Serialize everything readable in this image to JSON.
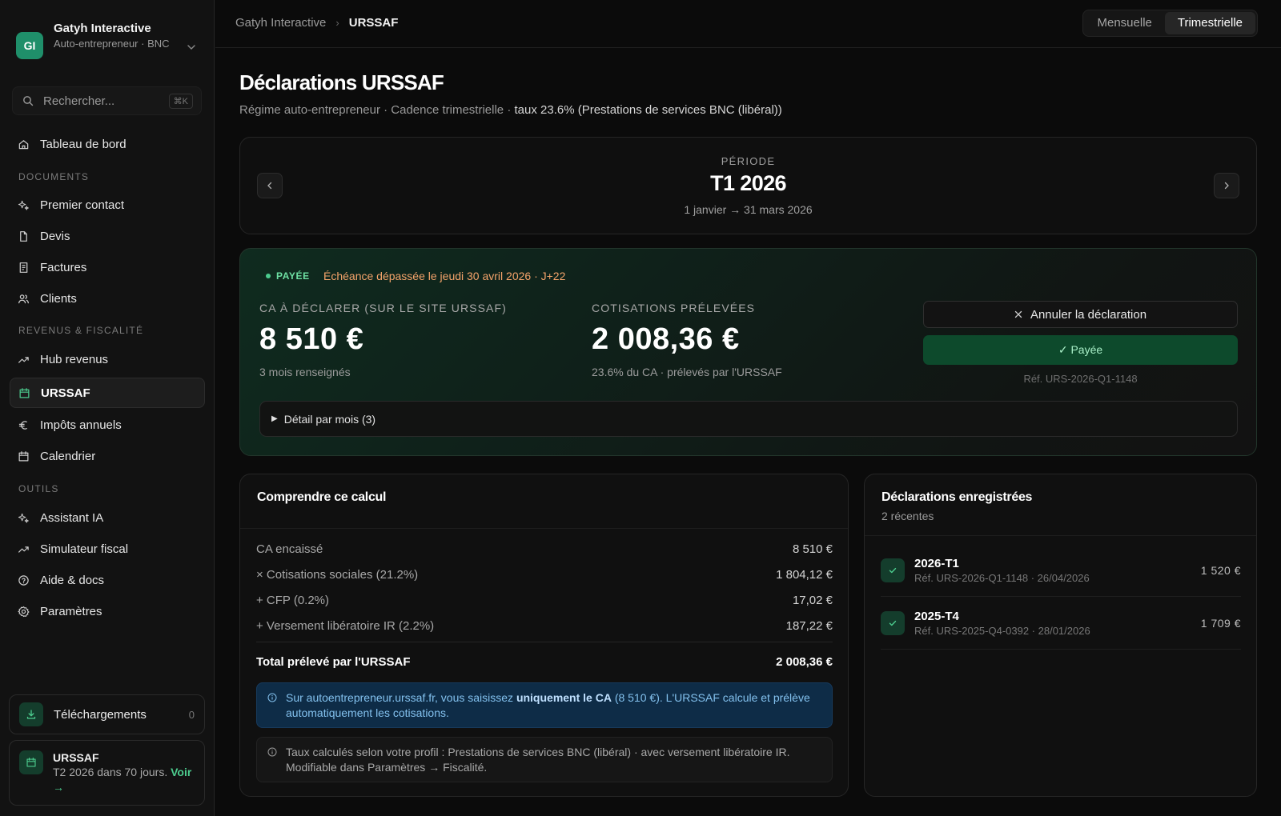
{
  "org": {
    "initials": "GI",
    "name": "Gatyh Interactive",
    "subtitle": "Auto-entrepreneur · BNC"
  },
  "search": {
    "placeholder": "Rechercher...",
    "shortcut": "⌘K"
  },
  "nav": {
    "dashboard": "Tableau de bord",
    "section_documents": "DOCUMENTS",
    "premier_contact": "Premier contact",
    "devis": "Devis",
    "factures": "Factures",
    "clients": "Clients",
    "section_revenus": "REVENUS & FISCALITÉ",
    "hub_revenus": "Hub revenus",
    "urssaf": "URSSAF",
    "impots": "Impôts annuels",
    "calendrier": "Calendrier",
    "section_outils": "OUTILS",
    "assistant": "Assistant IA",
    "simulateur": "Simulateur fiscal",
    "aide": "Aide & docs",
    "parametres": "Paramètres"
  },
  "downloads": {
    "label": "Téléchargements",
    "count": "0"
  },
  "reminder": {
    "title": "URSSAF",
    "text": "T2 2026 dans 70 jours.",
    "link": "Voir →"
  },
  "breadcrumb": {
    "parent": "Gatyh Interactive",
    "separator": "›",
    "current": "URSSAF"
  },
  "cadence_toggle": {
    "monthly": "Mensuelle",
    "quarterly": "Trimestrielle",
    "selected": "Trimestrielle"
  },
  "page": {
    "title": "Déclarations URSSAF",
    "subtitle": "Régime auto-entrepreneur · Cadence trimestrielle · ",
    "subtitle_rate": "taux 23.6% (Prestations de services BNC (libéral))"
  },
  "period": {
    "label": "PÉRIODE",
    "value": "T1 2026",
    "range": "1 janvier → 31 mars 2026"
  },
  "status": {
    "badge": "PAYÉE",
    "due_text": "Échéance dépassée le jeudi 30 avril 2026 · J+22",
    "ca_label": "CA À DÉCLARER (SUR LE SITE URSSAF)",
    "ca_value": "8 510 €",
    "ca_note": "3 mois renseignés",
    "cot_label": "COTISATIONS PRÉLEVÉES",
    "cot_value": "2 008,36 €",
    "cot_note": "23.6% du CA · prélevés par l'URSSAF",
    "cancel_button": "Annuler la déclaration",
    "paid_button": "✓ Payée",
    "reference": "Réf. URS-2026-Q1-1148",
    "detail_toggle": "Détail par mois (3)"
  },
  "calc": {
    "title": "Comprendre ce calcul",
    "rows": [
      {
        "label": "CA encaissé",
        "value": "8 510 €"
      },
      {
        "label": "× Cotisations sociales (21.2%)",
        "value": "1 804,12 €"
      },
      {
        "label": "+ CFP (0.2%)",
        "value": "17,02 €"
      },
      {
        "label": "+ Versement libératoire IR (2.2%)",
        "value": "187,22 €"
      }
    ],
    "total_label": "Total prélevé par l'URSSAF",
    "total_value": "2 008,36 €",
    "info_pre": "Sur autoentrepreneur.urssaf.fr, vous saisissez ",
    "info_bold": "uniquement le CA",
    "info_post": " (8 510 €). L'URSSAF calcule et prélève automatiquement les cotisations.",
    "note": "Taux calculés selon votre profil : Prestations de services BNC (libéral) · avec versement libératoire IR. Modifiable dans Paramètres → Fiscalité."
  },
  "declarations": {
    "title": "Déclarations enregistrées",
    "subtitle": "2 récentes",
    "items": [
      {
        "name": "2026-T1",
        "ref": "Réf. URS-2026-Q1-1148 · 26/04/2026",
        "amount": "1 520 €"
      },
      {
        "name": "2025-T4",
        "ref": "Réf. URS-2025-Q4-0392 · 28/01/2026",
        "amount": "1 709 €"
      }
    ]
  },
  "colors": {
    "accent": "#4ccc8e",
    "warning": "#f4a36a",
    "info_bg": "#0e2c47",
    "paid_button_bg": "#0d4a2c"
  }
}
